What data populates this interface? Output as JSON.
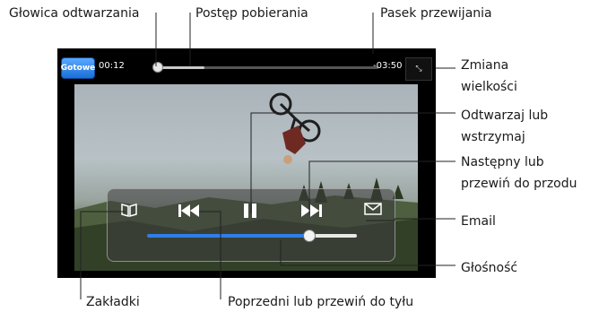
{
  "callouts": {
    "playhead": "Głowica odtwarzania",
    "download_progress": "Postęp pobierania",
    "scrubber": "Pasek przewijania",
    "resize_1": "Zmiana",
    "resize_2": "wielkości",
    "play_pause_1": "Odtwarzaj lub",
    "play_pause_2": "wstrzymaj",
    "next_1": "Następny lub",
    "next_2": "przewiń do przodu",
    "email": "Email",
    "volume": "Głośność",
    "bookmarks": "Zakładki",
    "previous": "Poprzedni lub przewiń do tyłu"
  },
  "player": {
    "done_label": "Gotowe",
    "elapsed": "00:12",
    "remaining": "-03:50",
    "scrub_position": 0.02,
    "download_progress": 0.22,
    "volume_level": 0.77
  },
  "icons": {
    "bookmarks": "bookmarks-icon",
    "previous": "previous-icon",
    "play_pause": "pause-icon",
    "next": "next-icon",
    "email": "email-icon",
    "resize": "resize-icon"
  },
  "colors": {
    "accent_blue": "#2f7ee8",
    "done_button": "#1a6fd6"
  }
}
